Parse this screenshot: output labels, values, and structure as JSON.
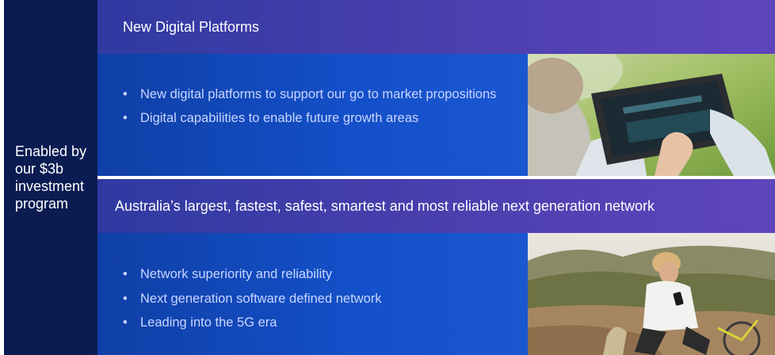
{
  "sidebar": {
    "label_lines": [
      "Enabled by",
      "our $3b",
      "investment",
      "program"
    ]
  },
  "section1": {
    "title": "New Digital Platforms",
    "bullets": [
      "New digital platforms to support our go to market propositions",
      "Digital capabilities to enable future growth areas"
    ],
    "image_icon": "tablet-photo-icon"
  },
  "section2": {
    "title": "Australia’s largest, fastest, safest, smartest and most reliable next generation network",
    "bullets": [
      "Network superiority and reliability",
      "Next generation software defined network",
      "Leading into the 5G era"
    ],
    "image_icon": "cyclist-phone-photo-icon"
  },
  "colors": {
    "sidebar": "#0a1c52",
    "band": "#4a3fae",
    "panel": "#1450c9",
    "bullet_text": "#c9d6ff"
  }
}
